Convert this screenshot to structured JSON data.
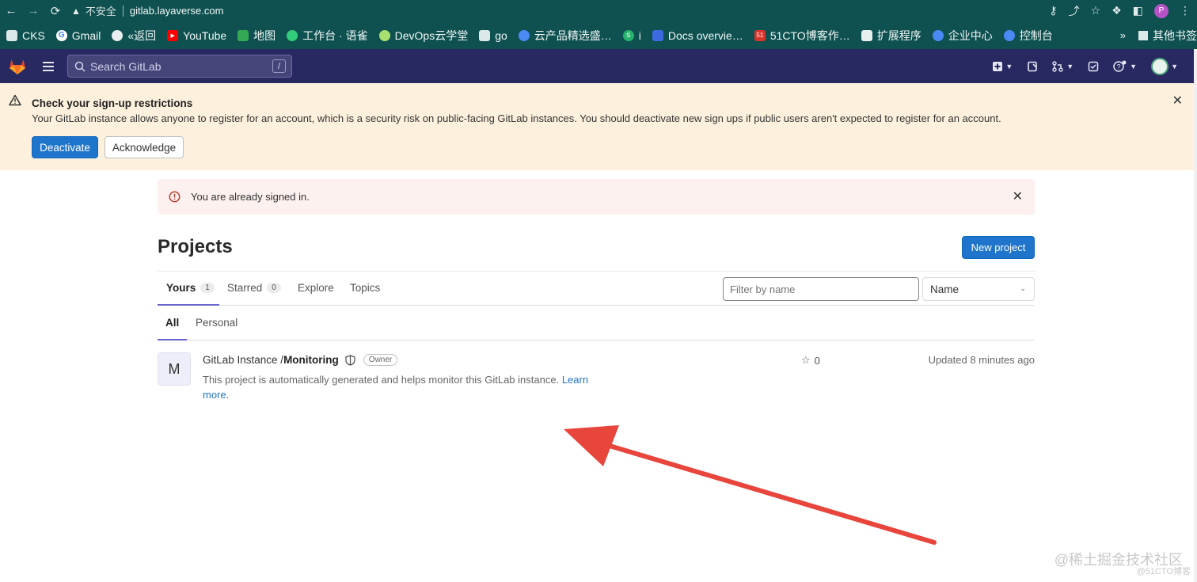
{
  "browser": {
    "insecure_label": "不安全",
    "url": "gitlab.layaverse.com",
    "profile_initial": "P",
    "bookmarks": [
      {
        "label": "CKS",
        "icon": "folder-icon"
      },
      {
        "label": "Gmail",
        "icon": "google-icon"
      },
      {
        "label": "«返回",
        "icon": "globe-icon"
      },
      {
        "label": "YouTube",
        "icon": "youtube-icon"
      },
      {
        "label": "地图",
        "icon": "map-icon"
      },
      {
        "label": "工作台 · 语雀",
        "icon": "yuque-icon"
      },
      {
        "label": "DevOps云学堂",
        "icon": "devops-icon"
      },
      {
        "label": "go",
        "icon": "folder-icon"
      },
      {
        "label": "云产品精选盛…",
        "icon": "cloud-icon"
      },
      {
        "label": "i",
        "icon": "s-icon"
      },
      {
        "label": "Docs overvie…",
        "icon": "docs-icon"
      },
      {
        "label": "51CTO博客作…",
        "icon": "51cto-icon"
      },
      {
        "label": "扩展程序",
        "icon": "puzzle-icon"
      },
      {
        "label": "企业中心",
        "icon": "cloud-icon"
      },
      {
        "label": "控制台",
        "icon": "cloud-icon"
      }
    ],
    "more": "»",
    "other_bookmarks": "其他书签"
  },
  "header": {
    "search_placeholder": "Search GitLab",
    "search_shortcut": "/"
  },
  "banner": {
    "title": "Check your sign-up restrictions",
    "body": "Your GitLab instance allows anyone to register for an account, which is a security risk on public-facing GitLab instances. You should deactivate new sign ups if public users aren't expected to register for an account.",
    "deactivate_label": "Deactivate",
    "acknowledge_label": "Acknowledge"
  },
  "alert": {
    "text": "You are already signed in."
  },
  "projects": {
    "title": "Projects",
    "new_project_label": "New project",
    "tabs": [
      {
        "label": "Yours",
        "count": "1"
      },
      {
        "label": "Starred",
        "count": "0"
      },
      {
        "label": "Explore"
      },
      {
        "label": "Topics"
      }
    ],
    "filter_placeholder": "Filter by name",
    "sort_selected": "Name",
    "subtabs": [
      "All",
      "Personal"
    ],
    "list": [
      {
        "avatar_letter": "M",
        "namespace": "GitLab Instance / ",
        "name": "Monitoring",
        "role": "Owner",
        "description": "This project is automatically generated and helps monitor this GitLab instance.",
        "learn_more": "Learn more.",
        "stars": "0",
        "updated": "Updated 8 minutes ago"
      }
    ]
  },
  "watermark": {
    "main": "@稀土掘金技术社区",
    "sub": "@51CTO博客"
  },
  "colors": {
    "browser_bar": "#0e5150",
    "gitlab_header": "#292961",
    "banner_bg": "#fdf1dd",
    "alert_bg": "#fcf1ef",
    "primary": "#1f75cb",
    "annotation_arrow": "#e8453c"
  }
}
